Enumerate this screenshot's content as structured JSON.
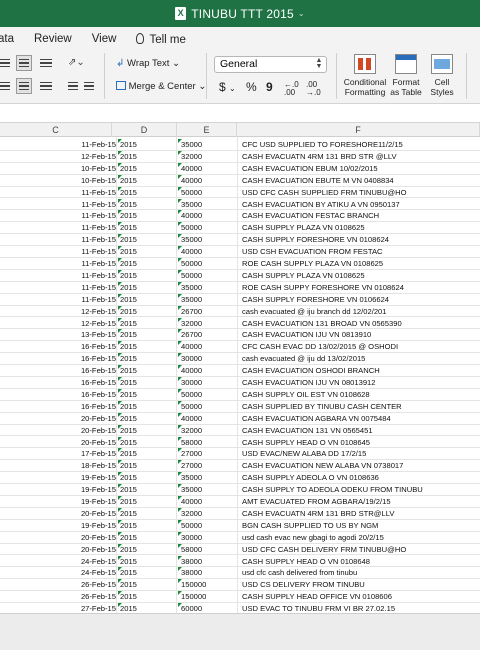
{
  "window": {
    "title": "TINUBU TTT 2015",
    "app_icon": "excel-icon"
  },
  "menu": {
    "items": [
      "ata",
      "Review",
      "View"
    ],
    "tell_me": "Tell me"
  },
  "ribbon": {
    "wrap_text": "Wrap Text",
    "merge_center": "Merge & Center",
    "number_format": "General",
    "currency": "$",
    "percent": "%",
    "comma": "9",
    "conditional_formatting": [
      "Conditional",
      "Formatting"
    ],
    "format_as_table": [
      "Format",
      "as Table"
    ],
    "cell_styles": [
      "Cell",
      "Styles"
    ]
  },
  "columns": [
    "C",
    "D",
    "E",
    "F"
  ],
  "rows": [
    {
      "date": "11-Feb-15",
      "year": "2015",
      "amount": "35000",
      "desc": "CFC USD SUPPLIED TO FORESHORE11/2/15"
    },
    {
      "date": "12-Feb-15",
      "year": "2015",
      "amount": "32000",
      "desc": "CASH EVACUATN 4RM 131 BRD STR @LLV"
    },
    {
      "date": "10-Feb-15",
      "year": "2015",
      "amount": "40000",
      "desc": "CASH EVACUATION EBUM 10/02/2015"
    },
    {
      "date": "10-Feb-15",
      "year": "2015",
      "amount": "40000",
      "desc": "CASH EVACUATION EBUTE M VN 0408834"
    },
    {
      "date": "11-Feb-15",
      "year": "2015",
      "amount": "50000",
      "desc": "USD CFC CASH SUPPLIED FRM TINUBU@HO"
    },
    {
      "date": "11-Feb-15",
      "year": "2015",
      "amount": "35000",
      "desc": "CASH EVACUATION BY ATIKU A VN 0950137"
    },
    {
      "date": "11-Feb-15",
      "year": "2015",
      "amount": "40000",
      "desc": "CASH EVACUATION FESTAC BRANCH"
    },
    {
      "date": "11-Feb-15",
      "year": "2015",
      "amount": "50000",
      "desc": "CASH SUPPLY PLAZA VN 0108625"
    },
    {
      "date": "11-Feb-15",
      "year": "2015",
      "amount": "35000",
      "desc": "CASH SUPPLY FORESHORE VN 0108624"
    },
    {
      "date": "11-Feb-15",
      "year": "2015",
      "amount": "40000",
      "desc": "USD CSH EVACUATION FROM FESTAC"
    },
    {
      "date": "11-Feb-15",
      "year": "2015",
      "amount": "50000",
      "desc": "ROE CASH SUPPLY PLAZA VN 0108625"
    },
    {
      "date": "11-Feb-15",
      "year": "2015",
      "amount": "50000",
      "desc": "CASH SUPPLY PLAZA VN 0108625"
    },
    {
      "date": "11-Feb-15",
      "year": "2015",
      "amount": "35000",
      "desc": "ROE CASH SUPPY FORESHORE VN 0108624"
    },
    {
      "date": "11-Feb-15",
      "year": "2015",
      "amount": "35000",
      "desc": "CASH SUPPLY FORESHORE VN 0106624"
    },
    {
      "date": "12-Feb-15",
      "year": "2015",
      "amount": "26700",
      "desc": "cash evacuated @ iju branch dd 12/02/201"
    },
    {
      "date": "12-Feb-15",
      "year": "2015",
      "amount": "32000",
      "desc": "CASH EVACUATION 131 BROAD VN 0565390"
    },
    {
      "date": "13-Feb-15",
      "year": "2015",
      "amount": "26700",
      "desc": "CASH EVACUATION IJU VN 0813910"
    },
    {
      "date": "16-Feb-15",
      "year": "2015",
      "amount": "40000",
      "desc": "CFC CASH EVAC DD 13/02/2015 @ OSHODI"
    },
    {
      "date": "16-Feb-15",
      "year": "2015",
      "amount": "30000",
      "desc": "cash evacuated @ iju dd 13/02/2015"
    },
    {
      "date": "16-Feb-15",
      "year": "2015",
      "amount": "40000",
      "desc": "CASH EVACUATION OSHODI BRANCH"
    },
    {
      "date": "16-Feb-15",
      "year": "2015",
      "amount": "30000",
      "desc": "CASH EVACUATION IJU VN 08013912"
    },
    {
      "date": "16-Feb-15",
      "year": "2015",
      "amount": "50000",
      "desc": "CASH SUPPLY OIL EST VN 0108628"
    },
    {
      "date": "16-Feb-15",
      "year": "2015",
      "amount": "50000",
      "desc": "CASH SUPPLIED  BY TINUBU  CASH CENTER"
    },
    {
      "date": "20-Feb-15",
      "year": "2015",
      "amount": "40000",
      "desc": "CASH EVACUATION AGBARA VN 0075484"
    },
    {
      "date": "20-Feb-15",
      "year": "2015",
      "amount": "32000",
      "desc": "CASH EVACUATION 131 VN 0565451"
    },
    {
      "date": "20-Feb-15",
      "year": "2015",
      "amount": "58000",
      "desc": "CASH SUPPLY HEAD O VN 0108645"
    },
    {
      "date": "17-Feb-15",
      "year": "2015",
      "amount": "27000",
      "desc": "USD EVAC/NEW ALABA DD 17/2/15"
    },
    {
      "date": "18-Feb-15",
      "year": "2015",
      "amount": "27000",
      "desc": "CASH EVACUATION NEW ALABA VN 0738017"
    },
    {
      "date": "19-Feb-15",
      "year": "2015",
      "amount": "35000",
      "desc": "CASH SUPPLY ADEOLA O VN 0108636"
    },
    {
      "date": "19-Feb-15",
      "year": "2015",
      "amount": "35000",
      "desc": "CASH SUPPLY TO ADEOLA ODEKU FROM TINUBU"
    },
    {
      "date": "19-Feb-15",
      "year": "2015",
      "amount": "40000",
      "desc": "AMT EVACUATED FROM AGBARA/19/2/15"
    },
    {
      "date": "20-Feb-15",
      "year": "2015",
      "amount": "32000",
      "desc": "CASH EVACUATN 4RM 131 BRD STR@LLV"
    },
    {
      "date": "19-Feb-15",
      "year": "2015",
      "amount": "50000",
      "desc": "BGN CASH SUPPLIED TO US BY NGM"
    },
    {
      "date": "20-Feb-15",
      "year": "2015",
      "amount": "30000",
      "desc": "usd cash evac new gbagi to agodi 20/2/15"
    },
    {
      "date": "20-Feb-15",
      "year": "2015",
      "amount": "58000",
      "desc": "USD CFC CASH DELIVERY FRM TINUBU@HO"
    },
    {
      "date": "24-Feb-15",
      "year": "2015",
      "amount": "38000",
      "desc": "CASH SUPPLY HEAD O VN 0108648"
    },
    {
      "date": "24-Feb-15",
      "year": "2015",
      "amount": "38000",
      "desc": "usd cfc cash delivered from tinubu"
    },
    {
      "date": "26-Feb-15",
      "year": "2015",
      "amount": "150000",
      "desc": "USD CS DELIVERY FROM TINUBU"
    },
    {
      "date": "26-Feb-15",
      "year": "2015",
      "amount": "150000",
      "desc": "CASH SUPPLY HEAD OFFICE VN 0108606"
    },
    {
      "date": "27-Feb-15",
      "year": "2015",
      "amount": "60000",
      "desc": "USD EVAC TO TINUBU FRM VI BR 27.02.15"
    },
    {
      "date": "27-Feb-15",
      "year": "2015",
      "amount": "60000",
      "desc": "CASH EVACUATION ADEOLA H VN0595563"
    }
  ]
}
